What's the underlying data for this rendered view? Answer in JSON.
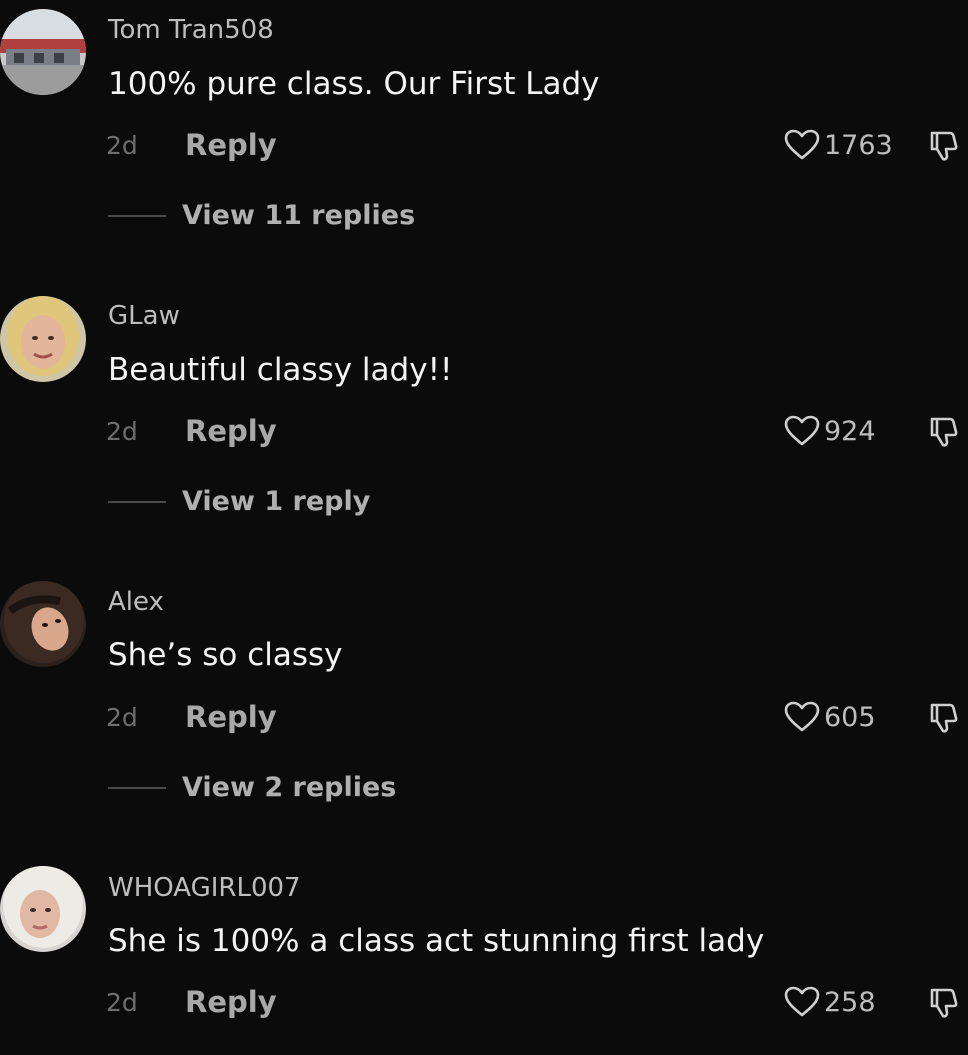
{
  "comments": [
    {
      "username": "Tom Tran508",
      "text": "100% pure class. Our First Lady",
      "time": "2d",
      "reply_label": "Reply",
      "likes": "1763",
      "view_replies": "View 11 replies",
      "avatar": "photo-storefront"
    },
    {
      "username": "GLaw",
      "text": "Beautiful classy lady!!",
      "time": "2d",
      "reply_label": "Reply",
      "likes": "924",
      "view_replies": "View 1 reply",
      "avatar": "photo-blonde-woman"
    },
    {
      "username": "Alex",
      "text": "She’s so classy",
      "time": "2d",
      "reply_label": "Reply",
      "likes": "605",
      "view_replies": "View 2 replies",
      "avatar": "photo-dark-hair-woman"
    },
    {
      "username": "WHOAGIRL007",
      "text": "She is 100% a class act stunning first lady",
      "time": "2d",
      "reply_label": "Reply",
      "likes": "258",
      "avatar": "photo-platinum-hair-woman"
    }
  ],
  "icons": {
    "like": "heart-outline-icon",
    "dislike": "thumbs-down-outline-icon"
  },
  "colors": {
    "background": "#0b0b0b",
    "username": "#bdbdbd",
    "text": "#f4f4f4",
    "muted": "#6e6e6e"
  }
}
